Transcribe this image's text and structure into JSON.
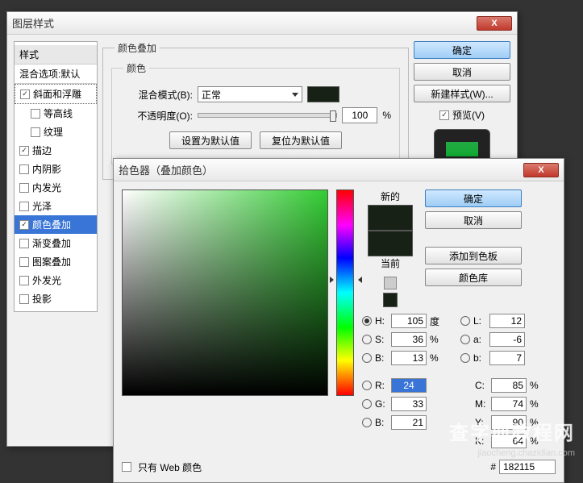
{
  "layerStyle": {
    "title": "图层样式",
    "stylesHeader": "样式",
    "blendOptions": "混合选项:默认",
    "items": [
      {
        "label": "斜面和浮雕",
        "checked": true,
        "indent": false,
        "active": true
      },
      {
        "label": "等高线",
        "checked": false,
        "indent": true
      },
      {
        "label": "纹理",
        "checked": false,
        "indent": true
      },
      {
        "label": "描边",
        "checked": true,
        "indent": false
      },
      {
        "label": "内阴影",
        "checked": false,
        "indent": false
      },
      {
        "label": "内发光",
        "checked": false,
        "indent": false
      },
      {
        "label": "光泽",
        "checked": false,
        "indent": false
      },
      {
        "label": "颜色叠加",
        "checked": true,
        "indent": false,
        "selected": true
      },
      {
        "label": "渐变叠加",
        "checked": false,
        "indent": false
      },
      {
        "label": "图案叠加",
        "checked": false,
        "indent": false
      },
      {
        "label": "外发光",
        "checked": false,
        "indent": false
      },
      {
        "label": "投影",
        "checked": false,
        "indent": false
      }
    ],
    "section": {
      "title": "颜色叠加",
      "subtitle": "颜色",
      "blendModeLabel": "混合模式(B):",
      "blendModeValue": "正常",
      "swatchColor": "#182115",
      "opacityLabel": "不透明度(O):",
      "opacityValue": "100",
      "opacityUnit": "%",
      "setDefault": "设置为默认值",
      "resetDefault": "复位为默认值"
    },
    "buttons": {
      "ok": "确定",
      "cancel": "取消",
      "newStyle": "新建样式(W)...",
      "preview": "预览(V)"
    }
  },
  "colorPicker": {
    "title": "拾色器（叠加颜色）",
    "newLabel": "新的",
    "currentLabel": "当前",
    "newColor": "#182115",
    "currentColor": "#182115",
    "smallSwatch": "#182115",
    "buttons": {
      "ok": "确定",
      "cancel": "取消",
      "addSwatch": "添加到色板",
      "colorLib": "颜色库"
    },
    "hsb": {
      "H": {
        "label": "H:",
        "value": "105",
        "unit": "度",
        "on": true
      },
      "S": {
        "label": "S:",
        "value": "36",
        "unit": "%"
      },
      "B": {
        "label": "B:",
        "value": "13",
        "unit": "%"
      }
    },
    "rgb": {
      "R": {
        "label": "R:",
        "value": "24",
        "sel": true
      },
      "G": {
        "label": "G:",
        "value": "33"
      },
      "B": {
        "label": "B:",
        "value": "21"
      }
    },
    "lab": {
      "L": {
        "label": "L:",
        "value": "12"
      },
      "a": {
        "label": "a:",
        "value": "-6"
      },
      "b": {
        "label": "b:",
        "value": "7"
      }
    },
    "cmyk": {
      "C": {
        "label": "C:",
        "value": "85",
        "unit": "%"
      },
      "M": {
        "label": "M:",
        "value": "74",
        "unit": "%"
      },
      "Y": {
        "label": "Y:",
        "value": "90",
        "unit": "%"
      },
      "K": {
        "label": "K:",
        "value": "64",
        "unit": "%"
      }
    },
    "webOnly": "只有 Web 颜色",
    "hexPrefix": "#",
    "hexValue": "182115"
  },
  "watermark": {
    "big": "查字典教程网",
    "small": "jiaocheng.chazidian.com"
  }
}
